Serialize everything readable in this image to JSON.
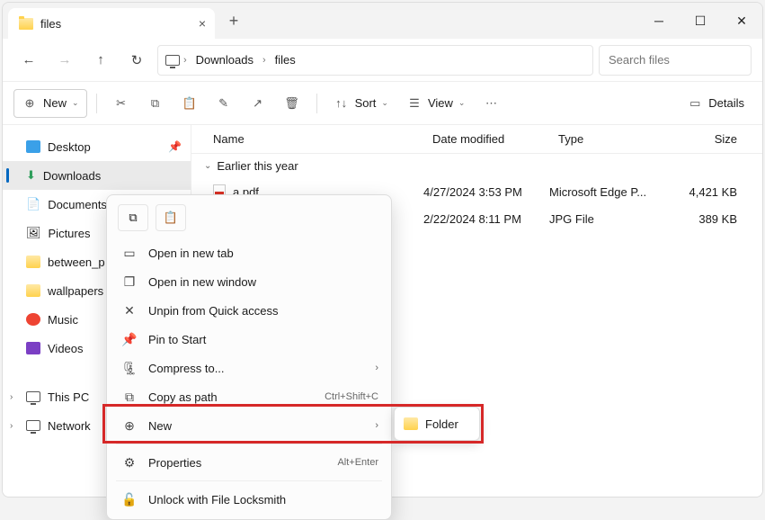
{
  "tab": {
    "title": "files"
  },
  "path": {
    "seg1": "Downloads",
    "seg2": "files"
  },
  "search": {
    "placeholder": "Search files"
  },
  "toolbar": {
    "new": "New",
    "sort": "Sort",
    "view": "View",
    "details": "Details"
  },
  "columns": {
    "name": "Name",
    "date": "Date modified",
    "type": "Type",
    "size": "Size"
  },
  "group": {
    "label": "Earlier this year"
  },
  "rows": [
    {
      "name": "a.pdf",
      "date": "4/27/2024 3:53 PM",
      "type": "Microsoft Edge P...",
      "size": "4,421 KB"
    },
    {
      "name": "",
      "date": "2/22/2024 8:11 PM",
      "type": "JPG File",
      "size": "389 KB"
    }
  ],
  "sidebar": {
    "desktop": "Desktop",
    "downloads": "Downloads",
    "documents": "Documents",
    "pictures": "Pictures",
    "between": "between_p",
    "wallpapers": "wallpapers",
    "music": "Music",
    "videos": "Videos",
    "thispc": "This PC",
    "network": "Network"
  },
  "ctx": {
    "open_tab": "Open in new tab",
    "open_win": "Open in new window",
    "unpin": "Unpin from Quick access",
    "pin_start": "Pin to Start",
    "compress": "Compress to...",
    "copy_path": "Copy as path",
    "copy_path_sc": "Ctrl+Shift+C",
    "new": "New",
    "properties": "Properties",
    "properties_sc": "Alt+Enter",
    "unlock": "Unlock with File Locksmith"
  },
  "submenu": {
    "folder": "Folder"
  }
}
